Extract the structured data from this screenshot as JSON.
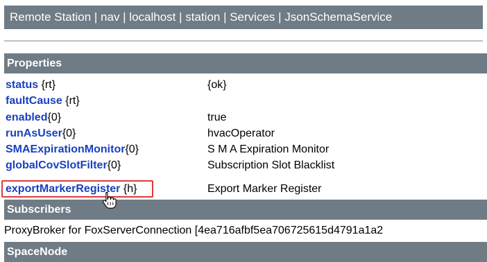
{
  "breadcrumb": "Remote Station | nav | localhost | station | Services | JsonSchemaService",
  "properties": {
    "header": "Properties",
    "rows": [
      {
        "name": "status",
        "flags": " {rt}",
        "value": "{ok}"
      },
      {
        "name": "faultCause",
        "flags": " {rt}",
        "value": ""
      },
      {
        "name": "enabled",
        "flags": "{0}",
        "value": "true"
      },
      {
        "name": "runAsUser",
        "flags": "{0}",
        "value": "hvacOperator"
      },
      {
        "name": "SMAExpirationMonitor",
        "flags": "{0}",
        "value": "S M A Expiration Monitor"
      },
      {
        "name": "globalCovSlotFilter",
        "flags": "{0}",
        "value": "Subscription Slot Blacklist"
      },
      {
        "name": "exportMarkerRegister",
        "flags": " {h}",
        "value": "Export Marker Register"
      }
    ]
  },
  "subscribers": {
    "header": "Subscribers",
    "rows": [
      "ProxyBroker for FoxServerConnection [4ea716afbf5ea706725615d4791a1a2"
    ]
  },
  "next_section": {
    "header": "SpaceNode"
  },
  "highlight_color": "#e0393a",
  "link_color": "#1a3fbf",
  "header_bg": "#6f7b85",
  "cursor_icon": "hand-pointer-icon"
}
